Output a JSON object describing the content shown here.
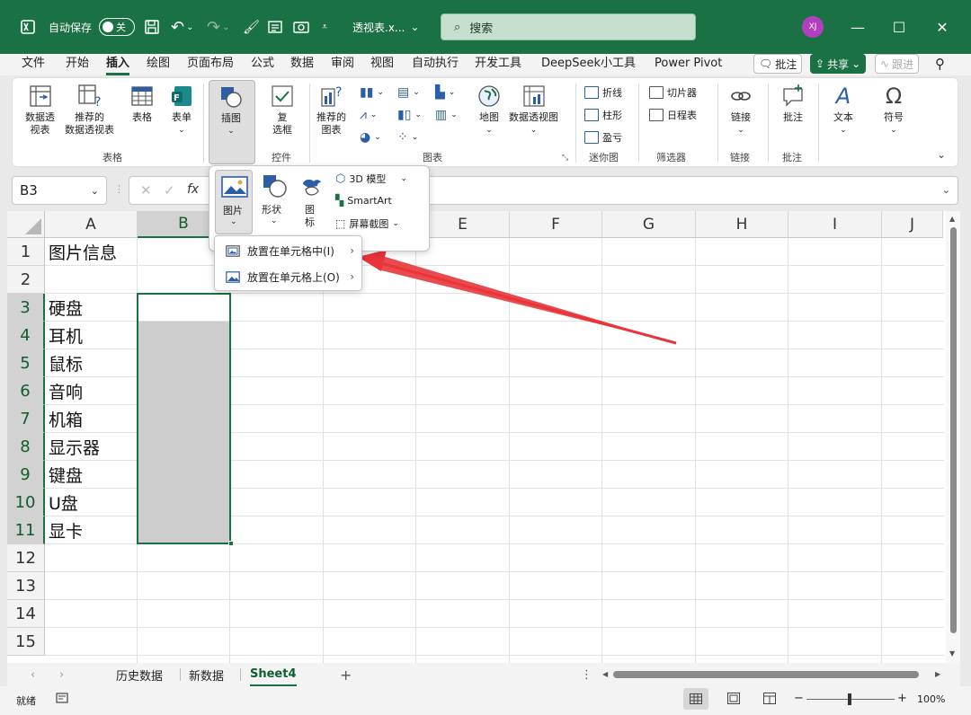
{
  "titlebar": {
    "autosave_label": "自动保存",
    "autosave_state": "关",
    "filename": "透视表.x...",
    "search_placeholder": "搜索",
    "avatar_initials": "XJ",
    "accent": "#1a7143"
  },
  "menu": {
    "tabs": [
      "文件",
      "开始",
      "插入",
      "绘图",
      "页面布局",
      "公式",
      "数据",
      "审阅",
      "视图",
      "自动执行",
      "开发工具",
      "DeepSeek小工具",
      "Power Pivot"
    ],
    "active_tab": "插入",
    "comments_label": "批注",
    "share_label": "共享",
    "follow_label": "跟进"
  },
  "ribbon": {
    "tables": {
      "pivot": "数据透\n视表",
      "recommended_pivot": "推荐的\n数据透视表",
      "table": "表格",
      "form": "表单",
      "group": "表格"
    },
    "illustrations": {
      "label": "插图"
    },
    "controls": {
      "checkbox": "复\n选框",
      "group": "控件"
    },
    "charts": {
      "recommended": "推荐的\n图表",
      "map": "地图",
      "pivot_chart": "数据透视图",
      "group": "图表"
    },
    "sparklines": {
      "line": "折线",
      "column": "柱形",
      "winloss": "盈亏",
      "group": "迷你图"
    },
    "filters": {
      "slicer": "切片器",
      "timeline": "日程表",
      "group": "筛选器"
    },
    "links": {
      "link": "链接",
      "group": "链接"
    },
    "comments": {
      "comment": "批注",
      "group": "批注"
    },
    "text": {
      "text": "文本"
    },
    "symbols": {
      "symbol": "符号"
    }
  },
  "insert_menu": {
    "picture": "图片",
    "shapes": "形状",
    "icons": "图\n标",
    "model3d": "3D 模型",
    "smartart": "SmartArt",
    "screenshot": "屏幕截图"
  },
  "picture_submenu": [
    {
      "label": "放置在单元格中(I)"
    },
    {
      "label": "放置在单元格上(O)"
    }
  ],
  "formula_bar": {
    "name_box": "B3",
    "fx": "fx"
  },
  "grid": {
    "columns": [
      "A",
      "B",
      "C",
      "D",
      "E",
      "F",
      "G",
      "H",
      "I",
      "J"
    ],
    "rows": [
      "1",
      "2",
      "3",
      "4",
      "5",
      "6",
      "7",
      "8",
      "9",
      "10",
      "11",
      "12",
      "13",
      "14",
      "15"
    ],
    "cells_A": [
      "图片信息",
      "",
      "硬盘",
      "耳机",
      "鼠标",
      "音响",
      "机箱",
      "显示器",
      "键盘",
      "U盘",
      "显卡"
    ]
  },
  "sheets": {
    "tabs": [
      "历史数据",
      "新数据",
      "Sheet4"
    ],
    "active": "Sheet4"
  },
  "status": {
    "ready": "就绪",
    "zoom": "100%"
  }
}
